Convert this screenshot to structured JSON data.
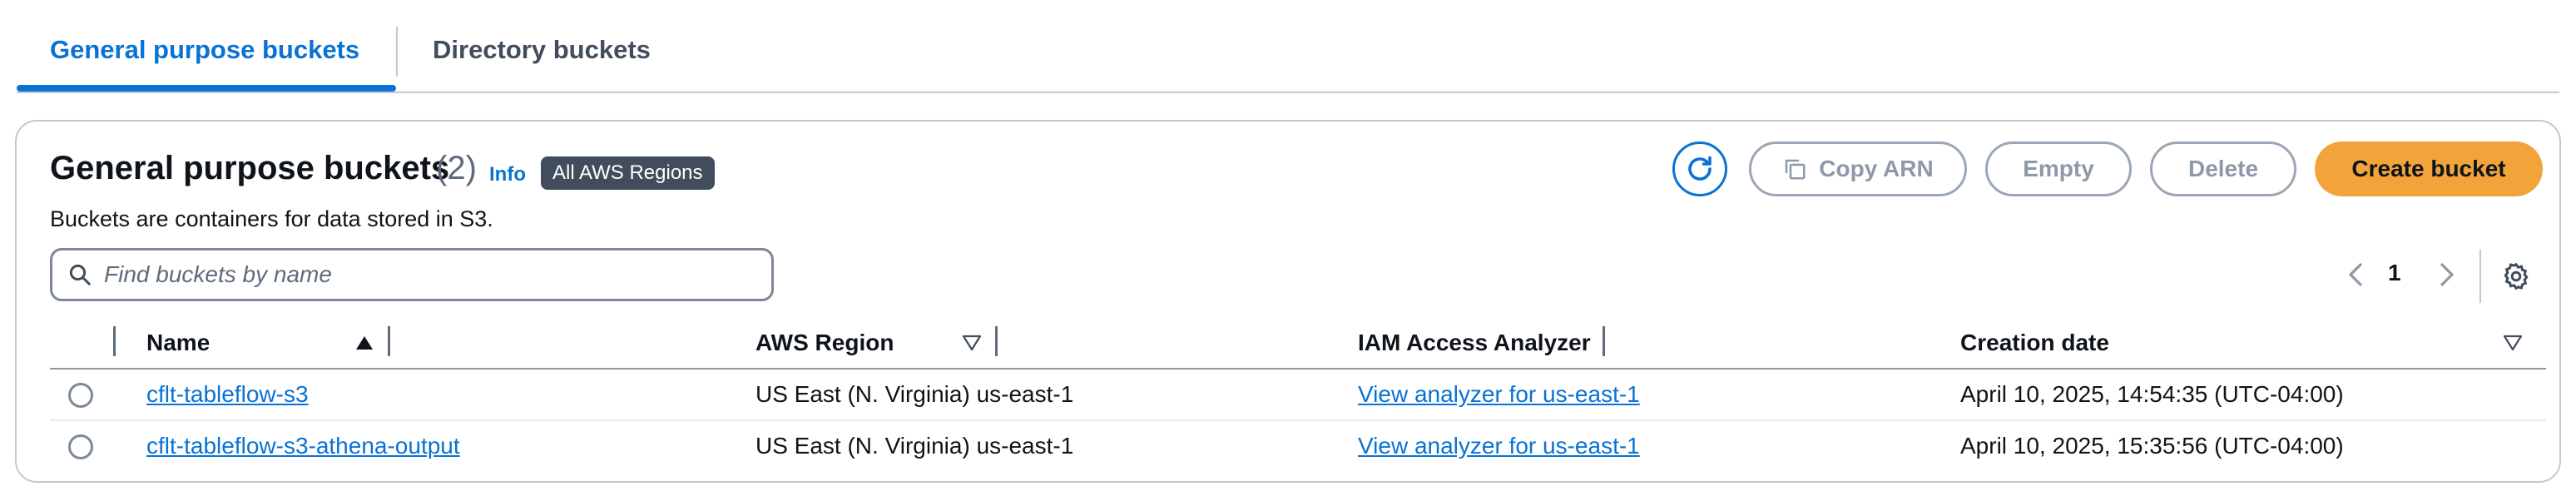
{
  "tabs": {
    "general": "General purpose buckets",
    "directory": "Directory buckets"
  },
  "header": {
    "title": "General purpose buckets",
    "count": "(2)",
    "info": "Info",
    "region_badge": "All AWS Regions",
    "description": "Buckets are containers for data stored in S3."
  },
  "actions": {
    "refresh_icon": "refresh-icon",
    "copy_arn": "Copy ARN",
    "empty": "Empty",
    "delete": "Delete",
    "create_bucket": "Create bucket"
  },
  "search": {
    "placeholder": "Find buckets by name"
  },
  "pagination": {
    "current_page": "1"
  },
  "table": {
    "columns": [
      "Name",
      "AWS Region",
      "IAM Access Analyzer",
      "Creation date"
    ],
    "rows": [
      {
        "name": "cflt-tableflow-s3",
        "region": "US East (N. Virginia) us-east-1",
        "analyzer": "View analyzer for us-east-1",
        "created": "April 10, 2025, 14:54:35 (UTC-04:00)"
      },
      {
        "name": "cflt-tableflow-s3-athena-output",
        "region": "US East (N. Virginia) us-east-1",
        "analyzer": "View analyzer for us-east-1",
        "created": "April 10, 2025, 15:35:56 (UTC-04:00)"
      }
    ]
  },
  "colors": {
    "accent": "#0972d3",
    "primary_button": "#f2a43a",
    "badge": "#414d5c",
    "disabled": "#8d99a8"
  }
}
